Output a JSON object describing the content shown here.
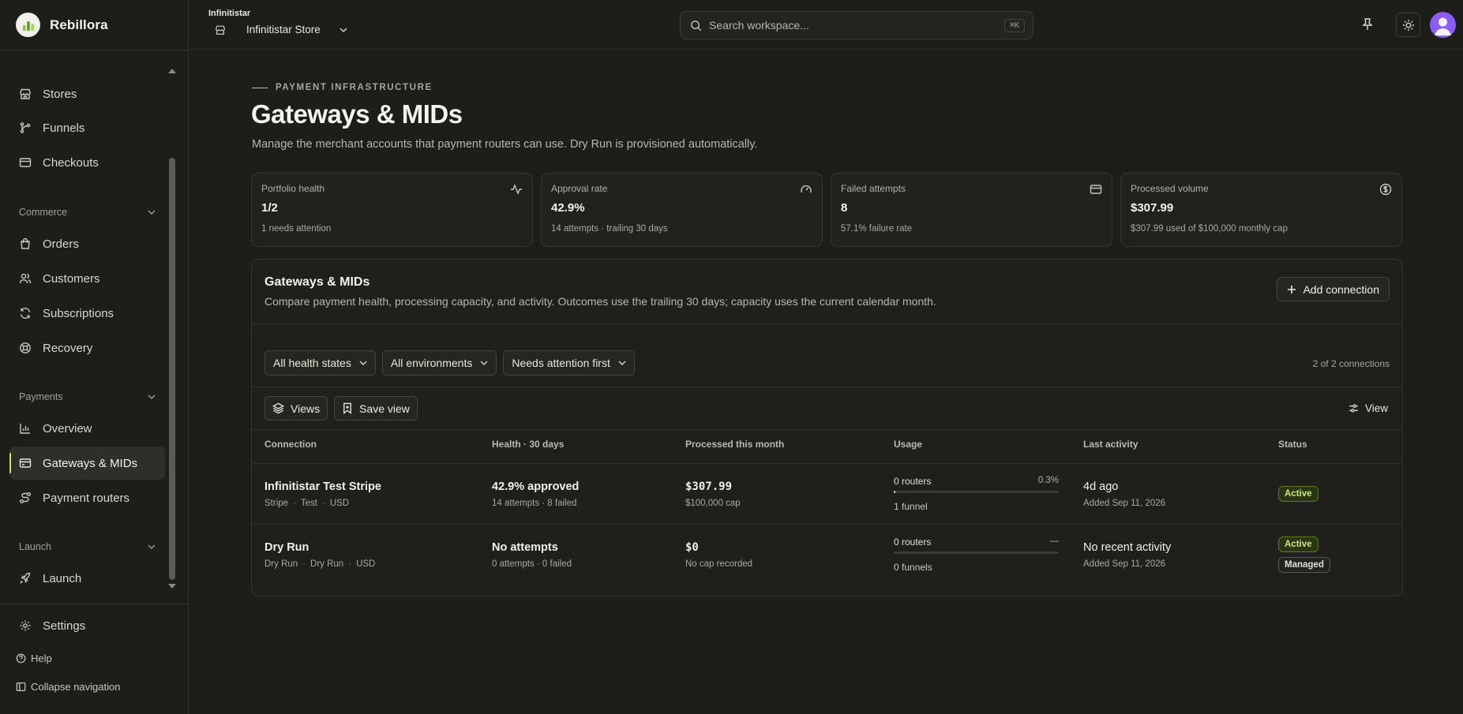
{
  "brand": {
    "name": "Rebillora"
  },
  "workspace": {
    "label": "Infinitistar",
    "store": "Infinitistar Store"
  },
  "search": {
    "placeholder": "Search workspace...",
    "shortcut": "⌘K"
  },
  "sidebar": {
    "items_top": [
      {
        "label": "Stores",
        "icon": "store-icon"
      },
      {
        "label": "Funnels",
        "icon": "funnel-icon"
      },
      {
        "label": "Checkouts",
        "icon": "checkout-icon"
      }
    ],
    "sections": {
      "commerce": "Commerce",
      "payments": "Payments",
      "launch": "Launch"
    },
    "commerce_items": [
      {
        "label": "Orders",
        "icon": "bag-icon"
      },
      {
        "label": "Customers",
        "icon": "users-icon"
      },
      {
        "label": "Subscriptions",
        "icon": "refresh-icon"
      },
      {
        "label": "Recovery",
        "icon": "lifebuoy-icon"
      }
    ],
    "payments_items": [
      {
        "label": "Overview",
        "icon": "chart-icon"
      },
      {
        "label": "Gateways & MIDs",
        "icon": "card-icon"
      },
      {
        "label": "Payment routers",
        "icon": "route-icon"
      }
    ],
    "launch_items": [
      {
        "label": "Launch",
        "icon": "rocket-icon"
      }
    ],
    "settings": "Settings",
    "help": "Help",
    "collapse": "Collapse navigation"
  },
  "page": {
    "eyebrow": "PAYMENT INFRASTRUCTURE",
    "title": "Gateways & MIDs",
    "description": "Manage the merchant accounts that payment routers can use. Dry Run is provisioned automatically."
  },
  "stats": [
    {
      "label": "Portfolio health",
      "value": "1/2",
      "sub": "1 needs attention",
      "icon": "activity-icon"
    },
    {
      "label": "Approval rate",
      "value": "42.9%",
      "sub": "14 attempts · trailing 30 days",
      "icon": "gauge-icon"
    },
    {
      "label": "Failed attempts",
      "value": "8",
      "sub": "57.1% failure rate",
      "icon": "card-icon"
    },
    {
      "label": "Processed volume",
      "value": "$307.99",
      "sub": "$307.99 used of $100,000 monthly cap",
      "icon": "dollar-icon"
    }
  ],
  "panel": {
    "title": "Gateways & MIDs",
    "description": "Compare payment health, processing capacity, and activity. Outcomes use the trailing 30 days; capacity uses the current calendar month.",
    "add_button": "Add connection",
    "filters": [
      "All health states",
      "All environments",
      "Needs attention first"
    ],
    "count": "2 of 2 connections",
    "views_button": "Views",
    "save_view_button": "Save view",
    "view_button": "View",
    "columns": [
      "Connection",
      "Health · 30 days",
      "Processed this month",
      "Usage",
      "Last activity",
      "Status"
    ],
    "rows": [
      {
        "name": "Infinitistar Test Stripe",
        "meta": [
          "Stripe",
          "Test",
          "USD"
        ],
        "health": "42.9% approved",
        "health_sub": "14 attempts · 8 failed",
        "processed": "$307.99",
        "processed_sub": "$100,000 cap",
        "routers": "0 routers",
        "usage_pct": "0.3%",
        "usage_fraction": 0.003,
        "funnels": "1 funnel",
        "last": "4d ago",
        "added": "Added Sep 11, 2026",
        "badges": [
          "Active"
        ]
      },
      {
        "name": "Dry Run",
        "meta": [
          "Dry Run",
          "Dry Run",
          "USD"
        ],
        "health": "No attempts",
        "health_sub": "0 attempts · 0 failed",
        "processed": "$0",
        "processed_sub": "No cap recorded",
        "routers": "0 routers",
        "usage_pct": "—",
        "usage_fraction": 0,
        "funnels": "0 funnels",
        "last": "No recent activity",
        "added": "Added Sep 11, 2026",
        "badges": [
          "Active",
          "Managed"
        ]
      }
    ]
  },
  "colors": {
    "accent": "#c4e85a",
    "background": "#1d1e1a",
    "avatar": "#8b5cf6"
  }
}
